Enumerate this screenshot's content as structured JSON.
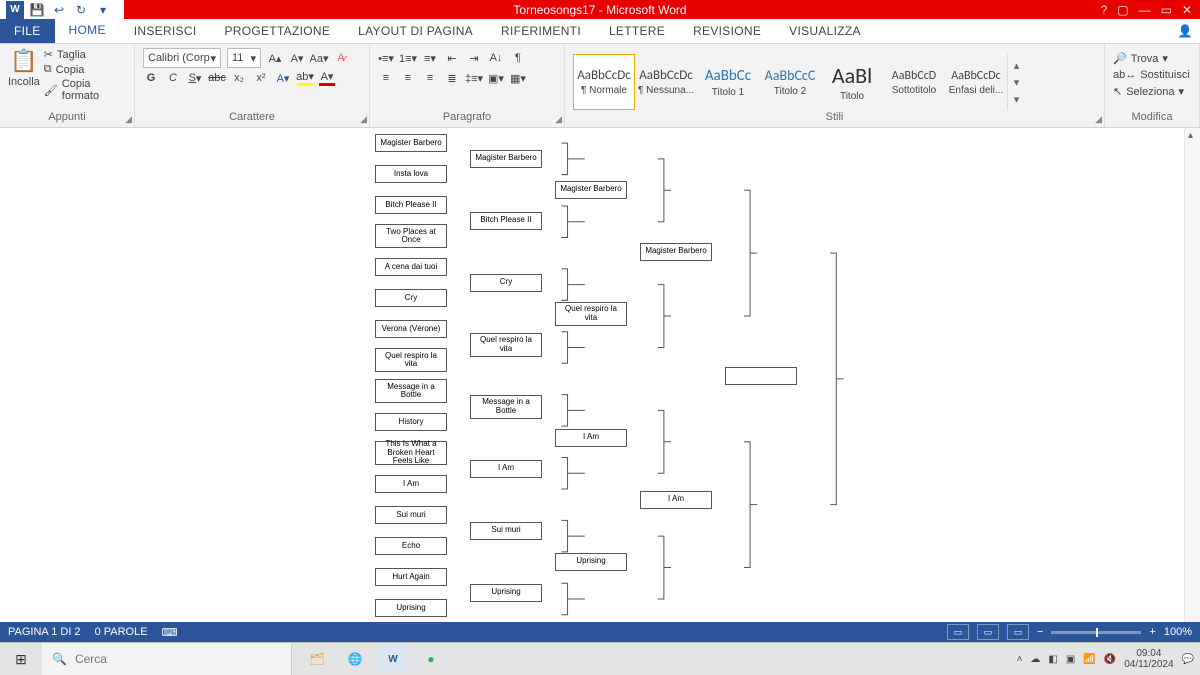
{
  "titlebar": {
    "title": "Torneosongs17 - Microsoft Word",
    "help": "?",
    "ribbon_opts": "▢",
    "min": "—",
    "max": "▭",
    "close": "✕"
  },
  "qat": {
    "word": "W",
    "save": "💾",
    "undo": "↩",
    "redo": "↻",
    "custom": "▾"
  },
  "tabs": {
    "file": "FILE",
    "home": "HOME",
    "insert": "INSERISCI",
    "design": "PROGETTAZIONE",
    "layout": "LAYOUT DI PAGINA",
    "refs": "RIFERIMENTI",
    "mail": "LETTERE",
    "review": "REVISIONE",
    "view": "VISUALIZZA"
  },
  "ribbon": {
    "clipboard": {
      "label": "Appunti",
      "paste": "Incolla",
      "cut": "Taglia",
      "copy": "Copia",
      "painter": "Copia formato"
    },
    "font": {
      "label": "Carattere",
      "name": "Calibri (Corp",
      "size": "11"
    },
    "paragraph": {
      "label": "Paragrafo"
    },
    "styles": {
      "label": "Stili",
      "items": [
        {
          "prev": "AaBbCcDc",
          "name": "¶ Normale",
          "size": "13"
        },
        {
          "prev": "AaBbCcDc",
          "name": "¶ Nessuna...",
          "size": "13"
        },
        {
          "prev": "AaBbCc",
          "name": "Titolo 1",
          "size": "15"
        },
        {
          "prev": "AaBbCcC",
          "name": "Titolo 2",
          "size": "14"
        },
        {
          "prev": "AaBl",
          "name": "Titolo",
          "size": "22"
        },
        {
          "prev": "AaBbCcD",
          "name": "Sottotitolo",
          "size": "12"
        },
        {
          "prev": "AaBbCcDc",
          "name": "Enfasi deli...",
          "size": "12"
        }
      ]
    },
    "editing": {
      "label": "Modifica",
      "find": "Trova",
      "replace": "Sostituisci",
      "select": "Seleziona"
    }
  },
  "bracket": {
    "r1": [
      "Magister Barbero",
      "Insta lova",
      "Bitch Please II",
      "Two Places at Once",
      "A cena dai tuoi",
      "Cry",
      "Verona (Vérone)",
      "Quel respiro la vita",
      "Message in a Bottle",
      "History",
      "This Is What a Broken Heart Feels Like",
      "I Am",
      "Sui muri",
      "Echo",
      "Hurt Again",
      "Uprising"
    ],
    "r2": [
      "Magister Barbero",
      "Bitch Please II",
      "Cry",
      "Quel respiro la vita",
      "Message in a Bottle",
      "I Am",
      "Sui muri",
      "Uprising"
    ],
    "r3": [
      "Magister Barbero",
      "Quel respiro la vita",
      "I Am",
      "Uprising"
    ],
    "r4": [
      "Magister Barbero",
      "I Am"
    ],
    "final": ""
  },
  "status": {
    "page": "PAGINA 1 DI 2",
    "words": "0 PAROLE",
    "lang_ic": "⌨",
    "zoom": "100%",
    "minus": "−",
    "plus": "+"
  },
  "taskbar": {
    "search_placeholder": "Cerca",
    "time": "09:04",
    "date": "04/11/2024"
  }
}
